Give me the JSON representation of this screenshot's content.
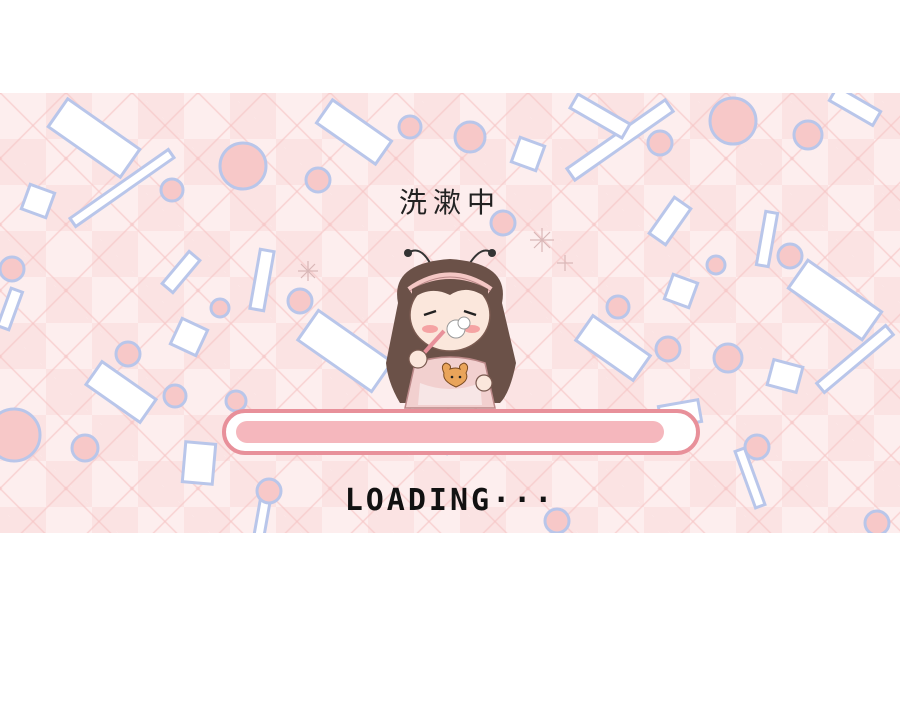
{
  "screen": {
    "title": "洗漱中",
    "loading_label": "LOADING···"
  },
  "progress": {
    "fraction": 0.95
  },
  "colors": {
    "background": "#fdeeee",
    "bar_border": "#e8909a",
    "bar_fill": "#f5b7bd",
    "shape_outline": "#b9c6ea",
    "circle_fill": "#f7c8c8"
  },
  "icons": {
    "character": "chibi-girl-washing-face"
  }
}
